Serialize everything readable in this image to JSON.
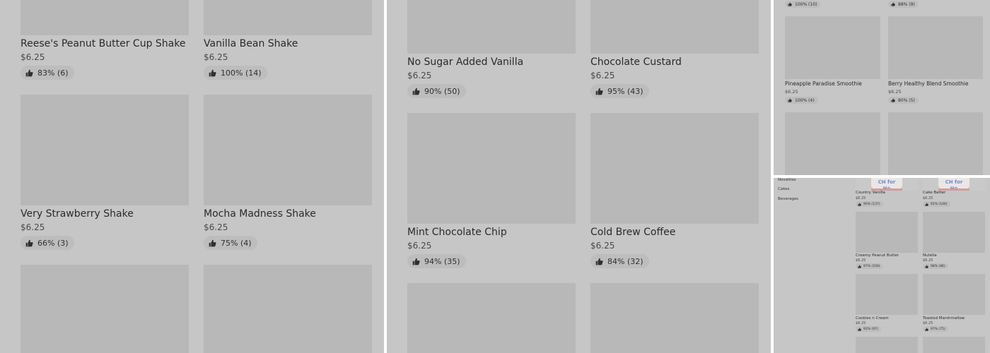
{
  "panels": {
    "a": {
      "items": [
        {
          "name": "Reese's Peanut Butter Cup Shake",
          "price": "$6.25",
          "rating": "83% (6)"
        },
        {
          "name": "Vanilla Bean Shake",
          "price": "$6.25",
          "rating": "100% (14)"
        },
        {
          "name": "Very Strawberry Shake",
          "price": "$6.25",
          "rating": "66% (3)"
        },
        {
          "name": "Mocha Madness Shake",
          "price": "$6.25",
          "rating": "75% (4)"
        }
      ]
    },
    "b": {
      "items": [
        {
          "name": "No Sugar Added Vanilla",
          "price": "$6.25",
          "rating": "90% (50)"
        },
        {
          "name": "Chocolate Custard",
          "price": "$6.25",
          "rating": "95% (43)"
        },
        {
          "name": "Mint Chocolate Chip",
          "price": "$6.25",
          "rating": "94% (35)"
        },
        {
          "name": "Cold Brew Coffee",
          "price": "$6.25",
          "rating": "84% (32)"
        }
      ]
    },
    "c": {
      "top_ratings": [
        "100% (10)",
        "88% (9)"
      ],
      "items": [
        {
          "name": "Pineapple Paradise Smoothie",
          "price": "$6.25",
          "rating": "100% (4)"
        },
        {
          "name": "Berry Healthy Blend Smoothie",
          "price": "$6.25",
          "rating": "80% (5)"
        }
      ]
    },
    "d": {
      "nav": [
        "Novelties",
        "Cakes",
        "Beverages"
      ],
      "cup_text": "CH for Ho",
      "items": [
        {
          "name": "Country Vanilla",
          "price": "$6.25",
          "rating": "90% (137)"
        },
        {
          "name": "Cake Batter",
          "price": "$6.25",
          "rating": "91% (146)"
        },
        {
          "name": "Creamy Peanut Butter",
          "price": "$6.25",
          "rating": "97% (100)"
        },
        {
          "name": "Nutella",
          "price": "$6.25",
          "rating": "98% (86)"
        },
        {
          "name": "Cookies n Cream",
          "price": "$6.25",
          "rating": "92% (97)"
        },
        {
          "name": "Toasted Marshmallow",
          "price": "$6.25",
          "rating": "97% (75)"
        }
      ]
    }
  },
  "icons": {
    "rating": "thumbs-up-icon"
  },
  "colors": {
    "overlay": "#c6c6c6",
    "image_placeholder": "#b8b8b8",
    "divider": "#ffffff"
  }
}
